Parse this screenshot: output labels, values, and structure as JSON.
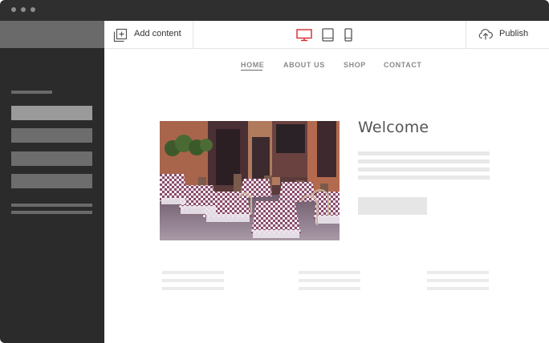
{
  "toolbar": {
    "add_content_label": "Add content",
    "publish_label": "Publish",
    "devices": [
      {
        "name": "desktop",
        "active": true
      },
      {
        "name": "tablet",
        "active": false
      },
      {
        "name": "phone",
        "active": false
      }
    ]
  },
  "site": {
    "nav": [
      {
        "label": "HOME",
        "active": true
      },
      {
        "label": "ABOUT US",
        "active": false
      },
      {
        "label": "SHOP",
        "active": false
      },
      {
        "label": "CONTACT",
        "active": false
      }
    ],
    "hero_heading": "Welcome"
  },
  "colors": {
    "titlebar": "#2f2f2f",
    "sidebar": "#2b2b2b",
    "active_device": "#d62b2b",
    "icon": "#555555"
  }
}
